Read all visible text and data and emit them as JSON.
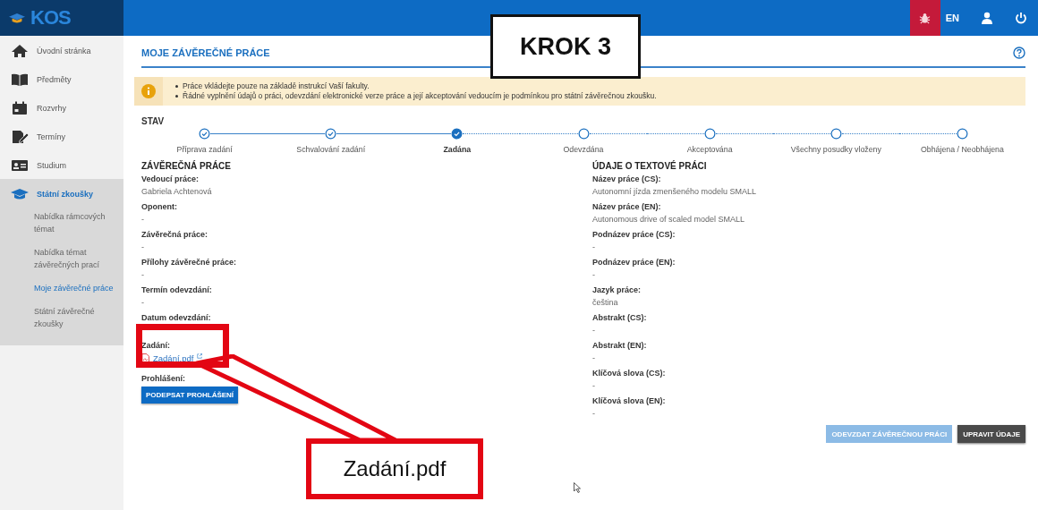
{
  "topbar": {
    "logo": "KOS",
    "language": "EN"
  },
  "sidebar": {
    "items": [
      {
        "label": "Úvodní stránka",
        "selected": false
      },
      {
        "label": "Předměty",
        "selected": false
      },
      {
        "label": "Rozvrhy",
        "selected": false
      },
      {
        "label": "Termíny",
        "selected": false
      },
      {
        "label": "Studium",
        "selected": false
      },
      {
        "label": "Státní zkoušky",
        "selected": true,
        "children": [
          {
            "label": "Nabídka rámcových témat",
            "selected": false
          },
          {
            "label": "Nabídka témat závěrečných prací",
            "selected": false
          },
          {
            "label": "Moje závěrečné práce",
            "selected": true
          },
          {
            "label": "Státní závěrečné zkoušky",
            "selected": false
          }
        ]
      }
    ]
  },
  "page": {
    "title": "MOJE ZÁVĚREČNÉ PRÁCE",
    "notices": [
      "Práce vkládejte pouze na základě instrukcí Vaší fakulty.",
      "Řádné vyplnění údajů o práci, odevzdání elektronické verze práce a její akceptování vedoucím je podmínkou pro státní závěrečnou zkoušku."
    ],
    "status": {
      "label": "STAV",
      "steps": [
        {
          "label": "Příprava zadání",
          "completed": true,
          "selected": false
        },
        {
          "label": "Schvalování zadání",
          "completed": true,
          "selected": false
        },
        {
          "label": "Zadána",
          "completed": true,
          "selected": true
        },
        {
          "label": "Odevzdána",
          "completed": false,
          "selected": false
        },
        {
          "label": "Akceptována",
          "completed": false,
          "selected": false
        },
        {
          "label": "Všechny posudky vloženy",
          "completed": false,
          "selected": false
        },
        {
          "label": "Obhájena / Neobhájena",
          "completed": false,
          "selected": false
        }
      ]
    },
    "thesis": {
      "heading": "ZÁVĚREČNÁ PRÁCE",
      "fields": [
        {
          "label": "Vedoucí práce:",
          "value": "Gabriela Achtenová"
        },
        {
          "label": "Oponent:",
          "value": "-"
        },
        {
          "label": "Závěrečná práce:",
          "value": "-"
        },
        {
          "label": "Přílohy závěrečné práce:",
          "value": "-"
        },
        {
          "label": "Termín odevzdání:",
          "value": "-"
        },
        {
          "label": "Datum odevzdání:"
        }
      ],
      "assignment": {
        "label": "Zadání:",
        "file": "Zadání.pdf"
      },
      "declaration": {
        "label": "Prohlášení:",
        "button": "PODEPSAT PROHLÁŠENÍ"
      }
    },
    "text_info": {
      "heading": "ÚDAJE O TEXTOVÉ PRÁCI",
      "fields": [
        {
          "label": "Název práce (CS):",
          "value": "Autonomní jízda zmenšeného modelu SMALL"
        },
        {
          "label": "Název práce (EN):",
          "value": "Autonomous drive of scaled model SMALL"
        },
        {
          "label": "Podnázev práce (CS):",
          "value": "-"
        },
        {
          "label": "Podnázev práce (EN):",
          "value": "-"
        },
        {
          "label": "Jazyk práce:",
          "value": "čeština"
        },
        {
          "label": "Abstrakt (CS):",
          "value": "-"
        },
        {
          "label": "Abstrakt (EN):",
          "value": "-"
        },
        {
          "label": "Klíčová slova (CS):",
          "value": "-"
        },
        {
          "label": "Klíčová slova (EN):",
          "value": "-"
        }
      ]
    },
    "actions": [
      {
        "label": "ODEVZDAT ZÁVĚREČNOU PRÁCI",
        "disabled": true
      },
      {
        "label": "UPRAVIT ÚDAJE",
        "disabled": false
      }
    ]
  },
  "annotations": {
    "step_badge": "KROK 3",
    "callout": "Zadání.pdf"
  }
}
